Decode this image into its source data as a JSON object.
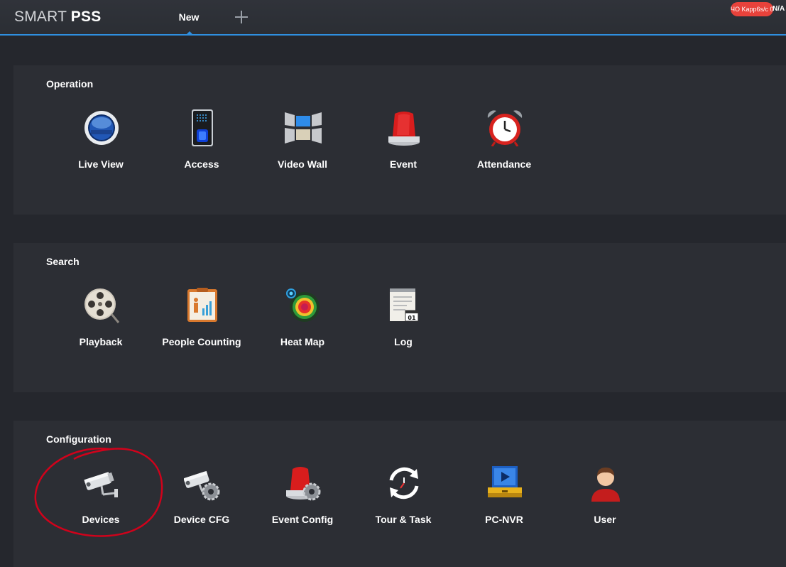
{
  "app": {
    "brand_light": "SMART",
    "brand_bold": "PSS",
    "accent_color": "#2f8fe0",
    "tabs": [
      {
        "label": "New"
      }
    ],
    "add_tab_icon": "plus-icon",
    "status_badge": "ЧО Kapp6s/c 0",
    "status_extra": "N/A"
  },
  "sections": {
    "operation": {
      "title": "Operation",
      "items": [
        {
          "label": "Live View",
          "icon": "live-view-icon"
        },
        {
          "label": "Access",
          "icon": "access-icon"
        },
        {
          "label": "Video Wall",
          "icon": "video-wall-icon"
        },
        {
          "label": "Event",
          "icon": "alarm-light-icon"
        },
        {
          "label": "Attendance",
          "icon": "alarm-clock-icon"
        }
      ]
    },
    "search": {
      "title": "Search",
      "items": [
        {
          "label": "Playback",
          "icon": "film-reel-icon"
        },
        {
          "label": "People Counting",
          "icon": "people-counting-icon"
        },
        {
          "label": "Heat Map",
          "icon": "heat-map-icon"
        },
        {
          "label": "Log",
          "icon": "log-notepad-icon"
        }
      ]
    },
    "configuration": {
      "title": "Configuration",
      "items": [
        {
          "label": "Devices",
          "icon": "camera-icon"
        },
        {
          "label": "Device CFG",
          "icon": "camera-gear-icon"
        },
        {
          "label": "Event Config",
          "icon": "alarm-gear-icon"
        },
        {
          "label": "Tour & Task",
          "icon": "tour-clock-icon"
        },
        {
          "label": "PC-NVR",
          "icon": "pc-nvr-icon"
        },
        {
          "label": "User",
          "icon": "user-icon"
        }
      ]
    }
  }
}
